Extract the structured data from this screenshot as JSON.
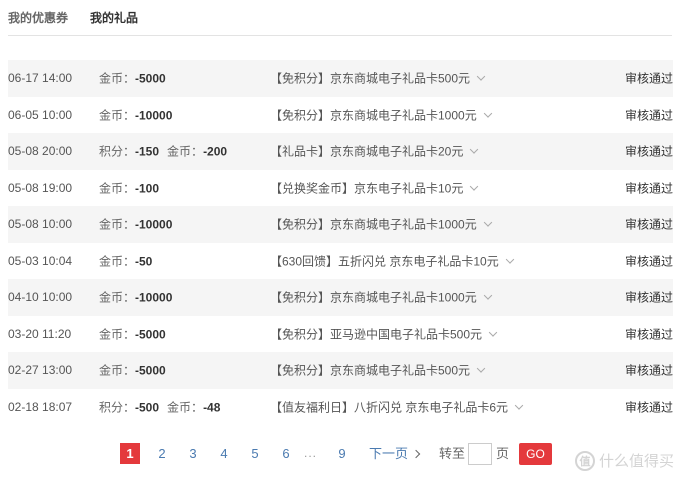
{
  "tabs": [
    {
      "label": "我的优惠券"
    },
    {
      "label": "我的礼品"
    }
  ],
  "amount_labels": {
    "gold": "金币：",
    "points": "积分："
  },
  "records": [
    {
      "time": "06-17 14:00",
      "points": "",
      "gold": "-5000",
      "item": "【免积分】京东商城电子礼品卡500元",
      "status": "审核通过"
    },
    {
      "time": "06-05 10:00",
      "points": "",
      "gold": "-10000",
      "item": "【免积分】京东商城电子礼品卡1000元",
      "status": "审核通过"
    },
    {
      "time": "05-08 20:00",
      "points": "-150",
      "gold": "-200",
      "item": "【礼品卡】京东商城电子礼品卡20元",
      "status": "审核通过"
    },
    {
      "time": "05-08 19:00",
      "points": "",
      "gold": "-100",
      "item": "【兑换奖金币】京东电子礼品卡10元",
      "status": "审核通过"
    },
    {
      "time": "05-08 10:00",
      "points": "",
      "gold": "-10000",
      "item": "【免积分】京东商城电子礼品卡1000元",
      "status": "审核通过"
    },
    {
      "time": "05-03 10:04",
      "points": "",
      "gold": "-50",
      "item": "【630回馈】五折闪兑 京东电子礼品卡10元",
      "status": "审核通过"
    },
    {
      "time": "04-10 10:00",
      "points": "",
      "gold": "-10000",
      "item": "【免积分】京东商城电子礼品卡1000元",
      "status": "审核通过"
    },
    {
      "time": "03-20 11:20",
      "points": "",
      "gold": "-5000",
      "item": "【免积分】亚马逊中国电子礼品卡500元",
      "status": "审核通过"
    },
    {
      "time": "02-27 13:00",
      "points": "",
      "gold": "-5000",
      "item": "【免积分】京东商城电子礼品卡500元",
      "status": "审核通过"
    },
    {
      "time": "02-18 18:07",
      "points": "-500",
      "gold": "-48",
      "item": "【值友福利日】八折闪兑 京东电子礼品卡6元",
      "status": "审核通过"
    }
  ],
  "pagination": {
    "pages": [
      "1",
      "2",
      "3",
      "4",
      "5",
      "6"
    ],
    "ellipsis": "...",
    "last_page": "9",
    "current": "1",
    "next_label": "下一页",
    "goto_label": "转至",
    "page_unit": "页",
    "go_label": "GO",
    "input_value": ""
  },
  "watermark": {
    "icon": "值",
    "text": "什么值得买"
  },
  "colors": {
    "accent": "#e4393c",
    "link": "#4a7ab0",
    "row_stripe": "#f5f5f5"
  }
}
